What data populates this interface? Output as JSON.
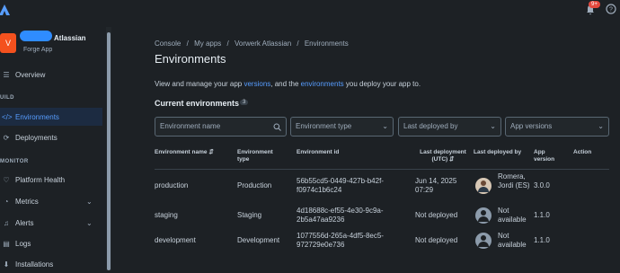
{
  "topbar": {
    "notif_badge": "9+"
  },
  "app": {
    "avatar_letter": "V",
    "name": "Atlassian",
    "subtitle": "Forge App"
  },
  "sidebar": {
    "overview": "Overview",
    "build_label": "UILD",
    "environments": "Environments",
    "deployments": "Deployments",
    "monitor_label": "MONITOR",
    "platform_health": "Platform Health",
    "metrics": "Metrics",
    "alerts": "Alerts",
    "logs": "Logs",
    "installations": "Installations"
  },
  "breadcrumb": {
    "console": "Console",
    "my_apps": "My apps",
    "app": "Vorwerk Atlassian",
    "current": "Environments",
    "sep": "/"
  },
  "page": {
    "title": "Environments",
    "desc_pre": "View and manage your app ",
    "desc_link1": "versions",
    "desc_mid": ", and the ",
    "desc_link2": "environments",
    "desc_post": " you deploy your app to.",
    "current_envs": "Current environments",
    "count": "3"
  },
  "filters": {
    "name_placeholder": "Environment name",
    "type": "Environment type",
    "last_deployed_by": "Last deployed by",
    "app_versions": "App versions"
  },
  "table": {
    "headers": {
      "name": "Environment name",
      "type": "Environment type",
      "id": "Environment id",
      "last_deploy": "Last deployment (UTC)",
      "deployed_by": "Last deployed by",
      "version": "App version",
      "action": "Action"
    },
    "rows": [
      {
        "name": "production",
        "type": "Production",
        "id": "56b55cd5-0449-427b-b42f-f0974c1b6c24",
        "last_deploy": "Jun 14, 2025 07:29",
        "deployed_by": "Romera, Jordi (ES)",
        "version": "3.0.0"
      },
      {
        "name": "staging",
        "type": "Staging",
        "id": "4d18688c-ef55-4e30-9c9a-2b5a47aa9236",
        "last_deploy": "Not deployed",
        "deployed_by": "Not available",
        "version": "1.1.0"
      },
      {
        "name": "development",
        "type": "Development",
        "id": "1077556d-265a-4df5-8ec5-972729e0e736",
        "last_deploy": "Not deployed",
        "deployed_by": "Not available",
        "version": "1.1.0"
      }
    ]
  }
}
